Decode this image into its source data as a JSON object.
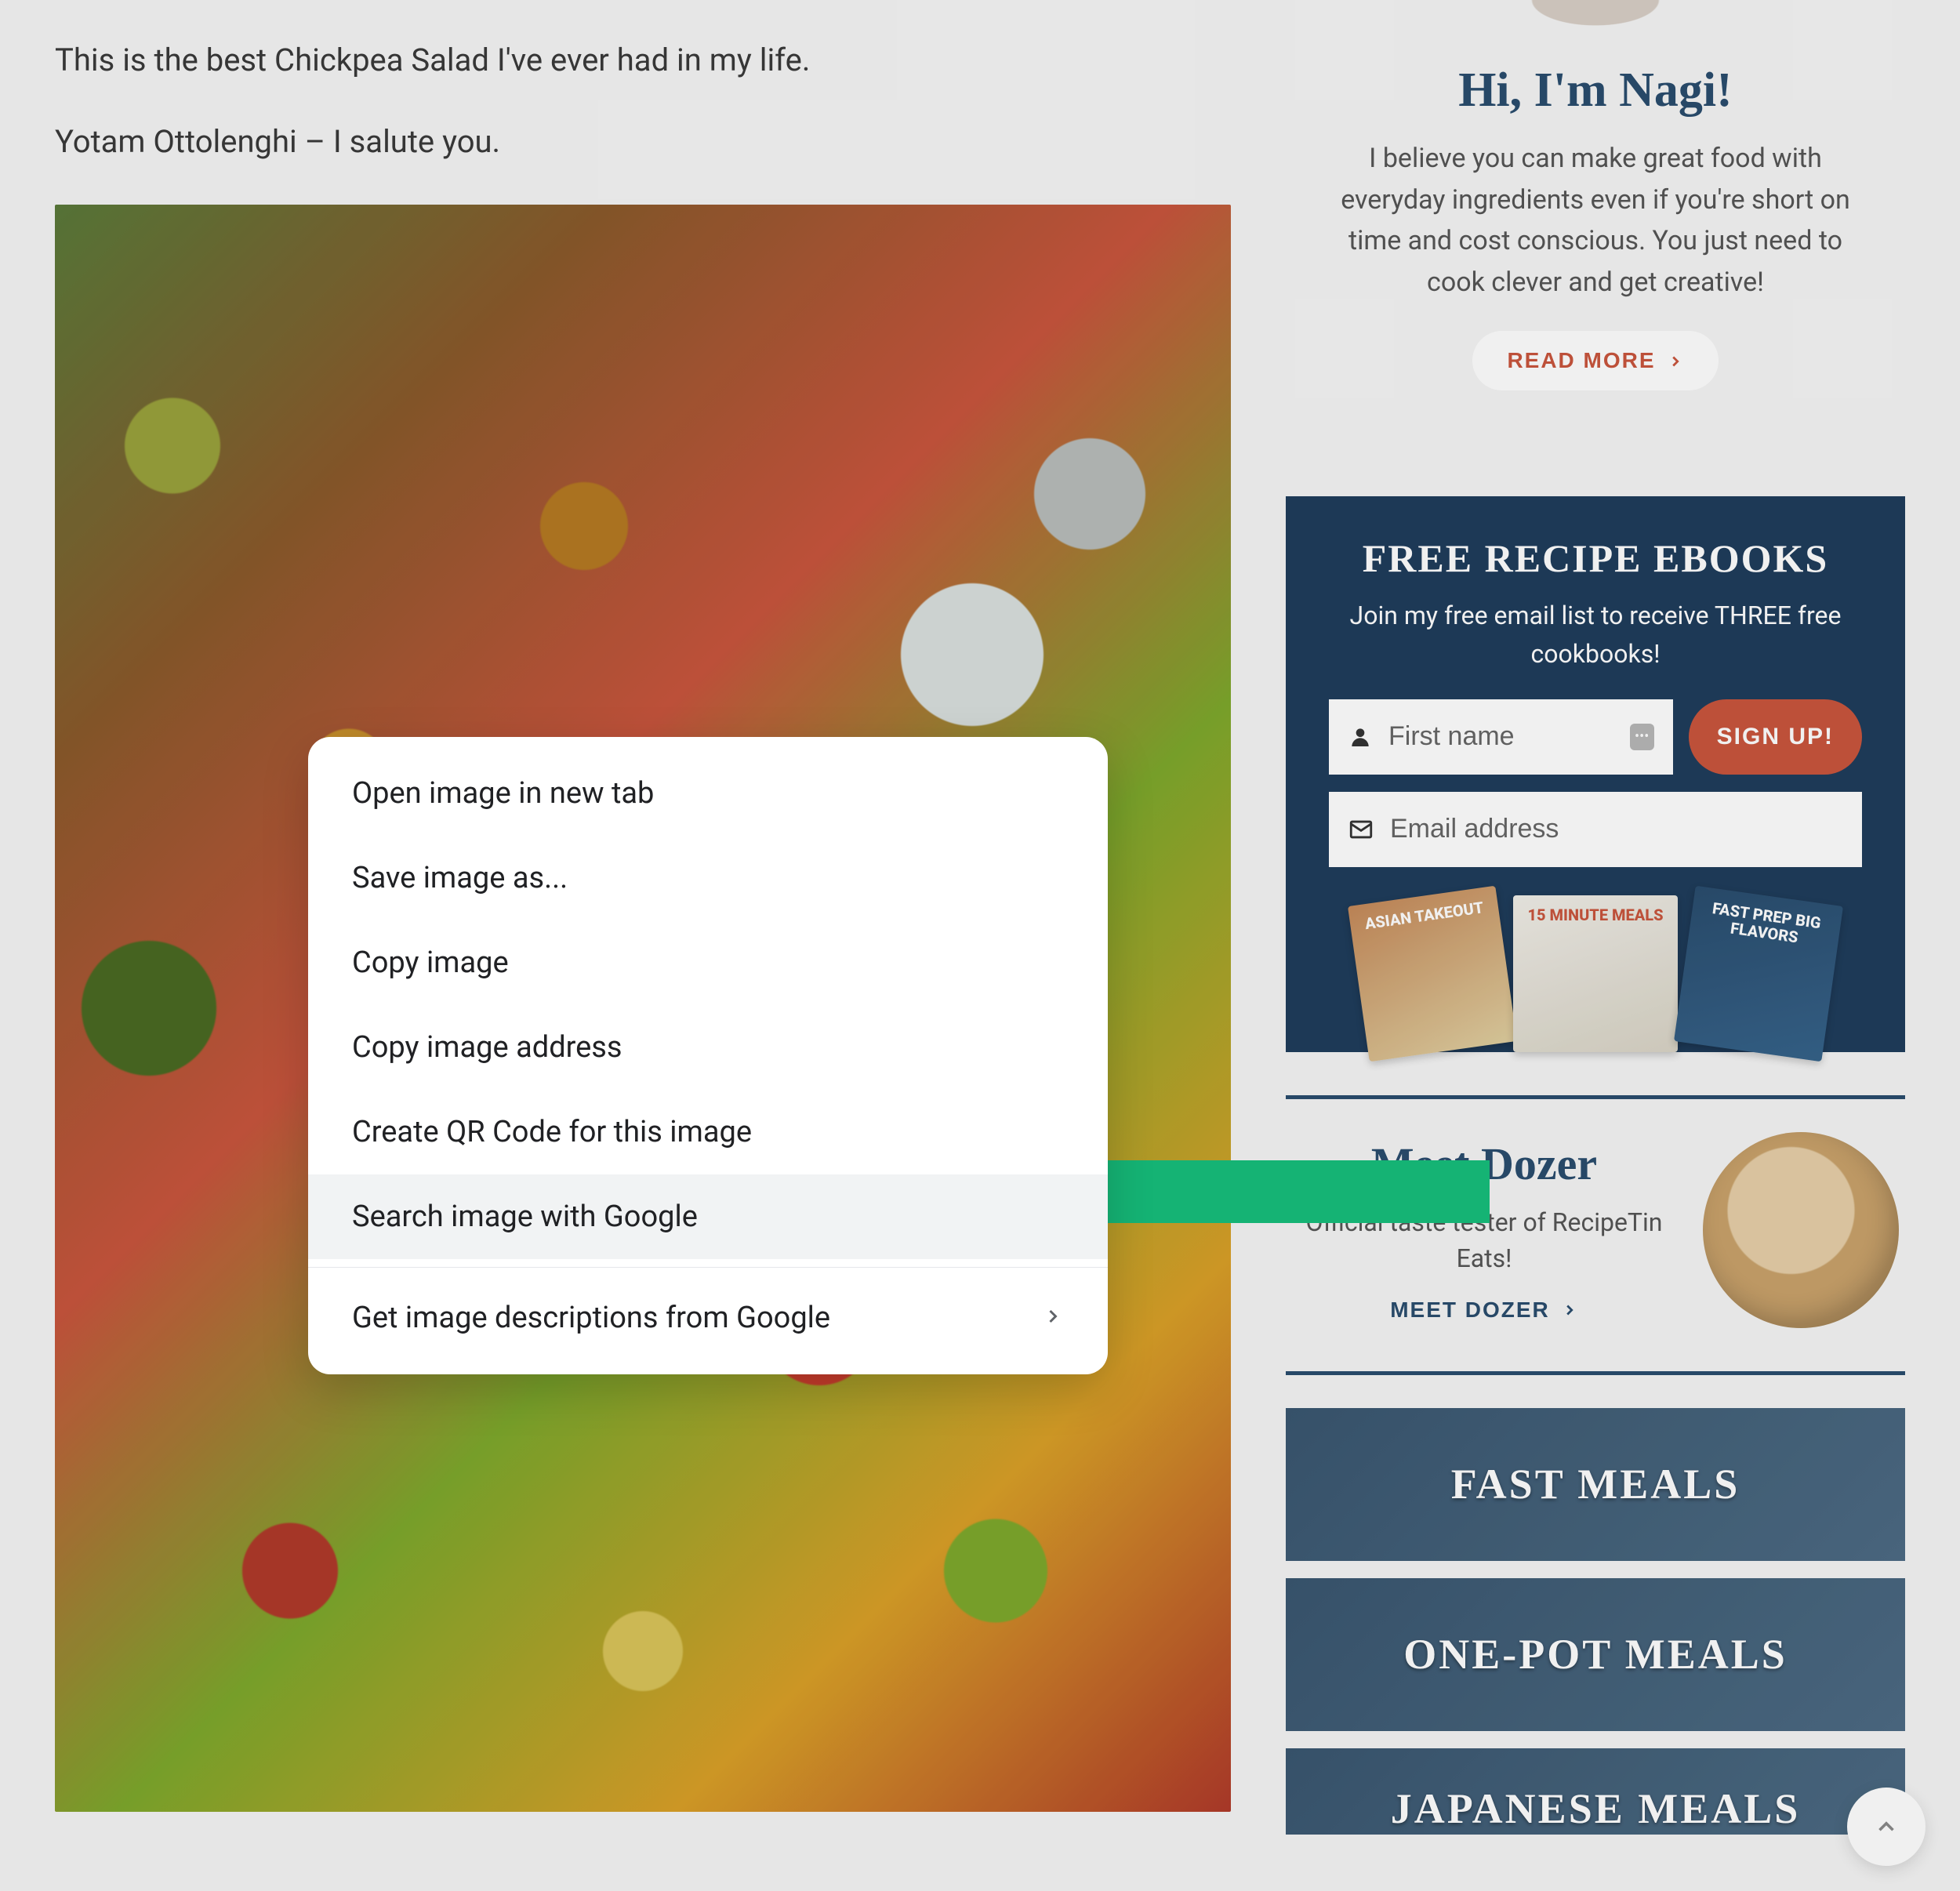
{
  "article": {
    "line1": "This is the best Chickpea Salad I've ever had in my life.",
    "line2": "Yotam Ottolenghi – I salute you."
  },
  "contextMenu": {
    "items": [
      {
        "label": "Open image in new tab",
        "hasSubmenu": false,
        "highlighted": false
      },
      {
        "label": "Save image as...",
        "hasSubmenu": false,
        "highlighted": false
      },
      {
        "label": "Copy image",
        "hasSubmenu": false,
        "highlighted": false
      },
      {
        "label": "Copy image address",
        "hasSubmenu": false,
        "highlighted": false
      },
      {
        "label": "Create QR Code for this image",
        "hasSubmenu": false,
        "highlighted": false
      },
      {
        "label": "Search image with Google",
        "hasSubmenu": false,
        "highlighted": true
      }
    ],
    "secondary": [
      {
        "label": "Get image descriptions from Google",
        "hasSubmenu": true,
        "highlighted": false
      }
    ]
  },
  "sidebar": {
    "intro": {
      "title": "Hi, I'm Nagi!",
      "desc": "I believe you can make great food with everyday ingredients even if you're short on time and cost conscious. You just need to cook clever and get creative!",
      "cta": "READ MORE"
    },
    "signup": {
      "title": "FREE RECIPE EBOOKS",
      "desc": "Join my free email list to receive THREE free cookbooks!",
      "first_name_placeholder": "First name",
      "email_placeholder": "Email address",
      "button": "SIGN UP!",
      "ebooks": [
        "ASIAN TAKEOUT",
        "15 MINUTE MEALS",
        "FAST PREP BIG FLAVORS"
      ]
    },
    "dozer": {
      "title": "Meet Dozer",
      "desc": "Official taste tester of RecipeTin Eats!",
      "cta": "MEET DOZER"
    },
    "categories": [
      "FAST MEALS",
      "ONE-POT MEALS",
      "JAPANESE MEALS"
    ]
  }
}
